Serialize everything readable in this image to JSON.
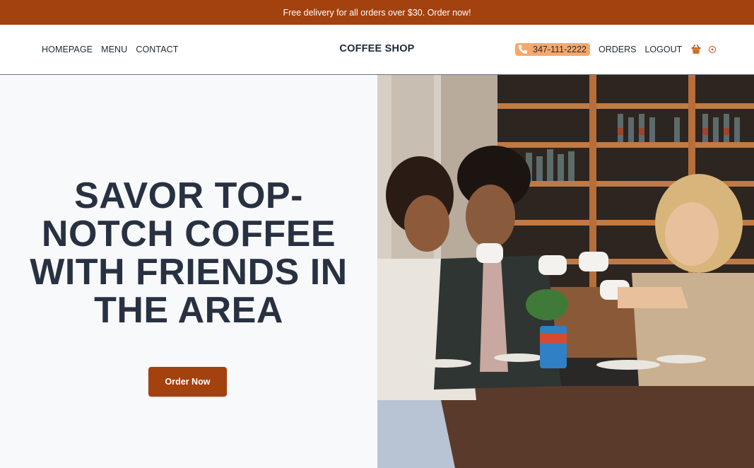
{
  "colors": {
    "accent": "#A3410F",
    "phone_pill": "#F5A86A",
    "title_text": "#283142",
    "hero_bg": "#F8F9FB"
  },
  "promo": {
    "text": "Free delivery for all orders over $30. Order now!"
  },
  "nav": {
    "left": [
      "HOMEPAGE",
      "MENU",
      "CONTACT"
    ],
    "brand": "COFFEE SHOP",
    "phone": "347-111-2222",
    "orders": "ORDERS",
    "logout": "LOGOUT",
    "icons": {
      "phone": "phone-icon",
      "cart": "basket-icon",
      "profile": "circle-icon"
    }
  },
  "hero": {
    "title": "SAVOR TOP-NOTCH COFFEE WITH FRIENDS IN THE AREA",
    "cta": "Order Now",
    "image_alt": "friends toasting coffee cups in cafe"
  }
}
